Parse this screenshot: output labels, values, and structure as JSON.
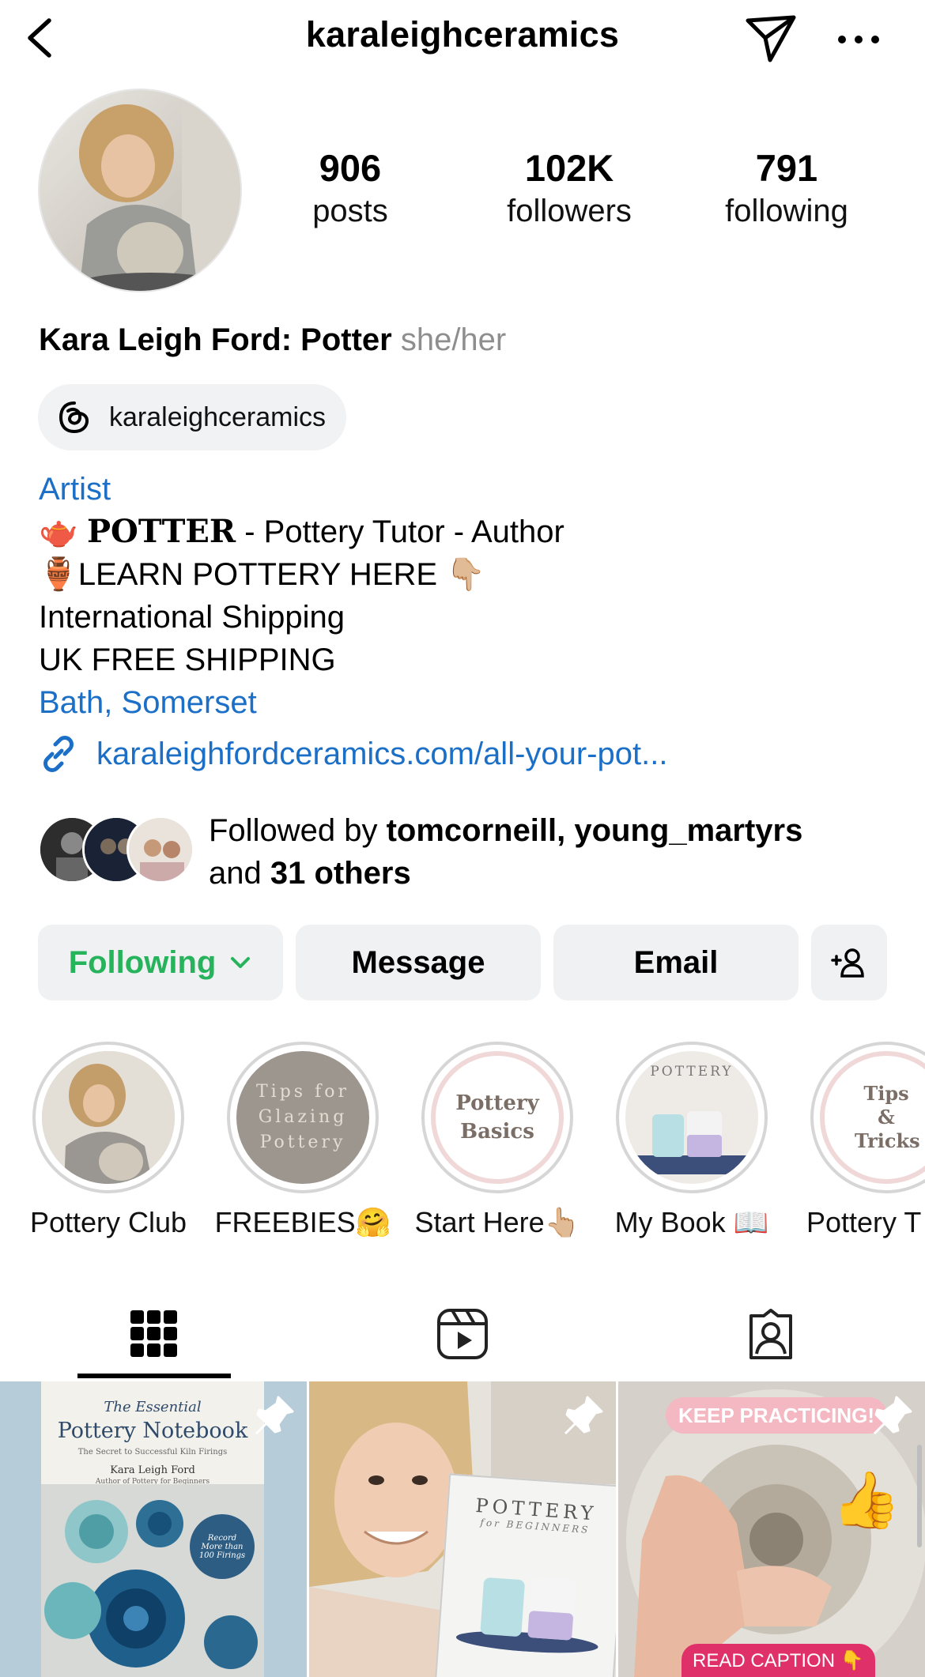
{
  "header": {
    "username": "karaleighceramics",
    "icons": [
      "chevron-left-icon",
      "send-icon",
      "more-icon"
    ]
  },
  "stats": {
    "posts": {
      "value": "906",
      "label": "posts"
    },
    "followers": {
      "value": "102K",
      "label": "followers"
    },
    "following": {
      "value": "791",
      "label": "following"
    }
  },
  "profile": {
    "name": "Kara Leigh Ford: Potter",
    "pronouns": "she/her",
    "threads_handle": "karaleighceramics",
    "category": "Artist",
    "bio_lines": [
      {
        "emoji": "🫖",
        "bold": "𝐏𝐎𝐓𝐓𝐄𝐑",
        "text": " - Pottery Tutor - Author"
      },
      {
        "emoji": "🏺",
        "text": "LEARN POTTERY HERE 👇🏼"
      },
      {
        "text": "International Shipping"
      },
      {
        "text": "UK FREE SHIPPING"
      }
    ],
    "location": "Bath, Somerset",
    "link": "karaleighfordceramics.com/all-your-pot..."
  },
  "followed_by": {
    "prefix": "Followed by ",
    "names": "tomcorneill, young_martyrs",
    "and": "and ",
    "others": "31 others"
  },
  "actions": {
    "following": "Following",
    "message": "Message",
    "email": "Email"
  },
  "highlights": [
    {
      "label": "Pottery Club",
      "cover_text": ""
    },
    {
      "label": "FREEBIES🤗",
      "cover_text": "Tips for Glazing Pottery"
    },
    {
      "label": "Start Here👆🏼",
      "cover_text": "Pottery Basics"
    },
    {
      "label": "My Book 📖",
      "cover_text": "POTTERY"
    },
    {
      "label": "Pottery T",
      "cover_text": "Tips & Tricks"
    }
  ],
  "tabs": [
    "grid-icon",
    "reels-icon",
    "tagged-icon"
  ],
  "posts": [
    {
      "title_top": "The Essential",
      "title_main": "Pottery Notebook",
      "subtitle": "The Secret to Successful Kiln Firings",
      "author": "Kara Leigh Ford",
      "author_note": "Author of Pottery for Beginners",
      "badge": "Record More than 100 Firings",
      "pinned": true
    },
    {
      "book_title": "POTTERY",
      "book_sub": "for BEGINNERS",
      "pinned": true
    },
    {
      "banner": "KEEP PRACTICING!",
      "caption_tag": "READ CAPTION 👇",
      "pinned": true
    }
  ],
  "colors": {
    "link_blue": "#1c6fc6",
    "following_green": "#26b35c",
    "button_bg": "#eff1f2",
    "muted": "#8e8e8e"
  }
}
